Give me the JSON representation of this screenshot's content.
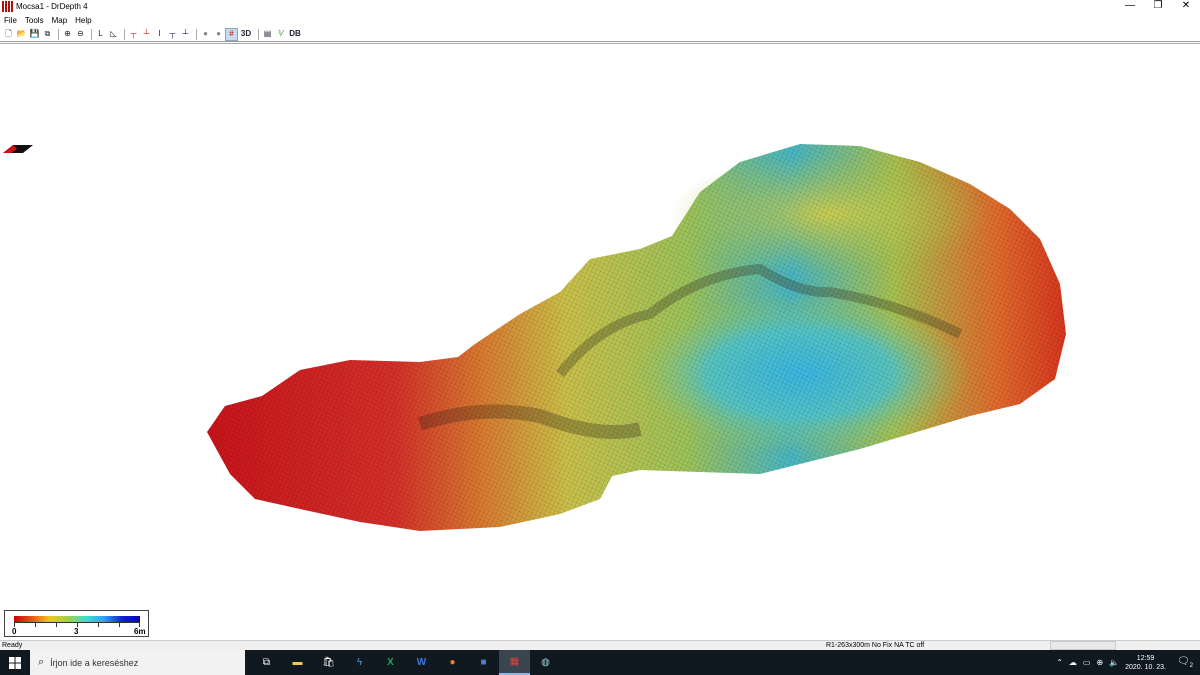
{
  "window": {
    "title": "Mocsa1 - DrDepth 4",
    "minimize_glyph": "—",
    "restore_glyph": "❐",
    "close_glyph": "✕"
  },
  "menu": {
    "items": [
      "File",
      "Tools",
      "Map",
      "Help"
    ]
  },
  "toolbar": {
    "threed_label": "3D",
    "db_label": "DB",
    "active_tool": "grid-view"
  },
  "legend": {
    "min_label": "0",
    "mid_label": "3",
    "max_label": "6m",
    "colors": [
      "#d00000",
      "#e8c730",
      "#47d8d0",
      "#0a0aa0"
    ]
  },
  "status": {
    "ready": "Ready",
    "info": "R1-263x300m  No Fix    NA  TC off"
  },
  "taskbar": {
    "search_placeholder": "Írjon ide a kereséshez",
    "time": "12:59",
    "date": "2020. 10. 23.",
    "notification_count": "2"
  }
}
